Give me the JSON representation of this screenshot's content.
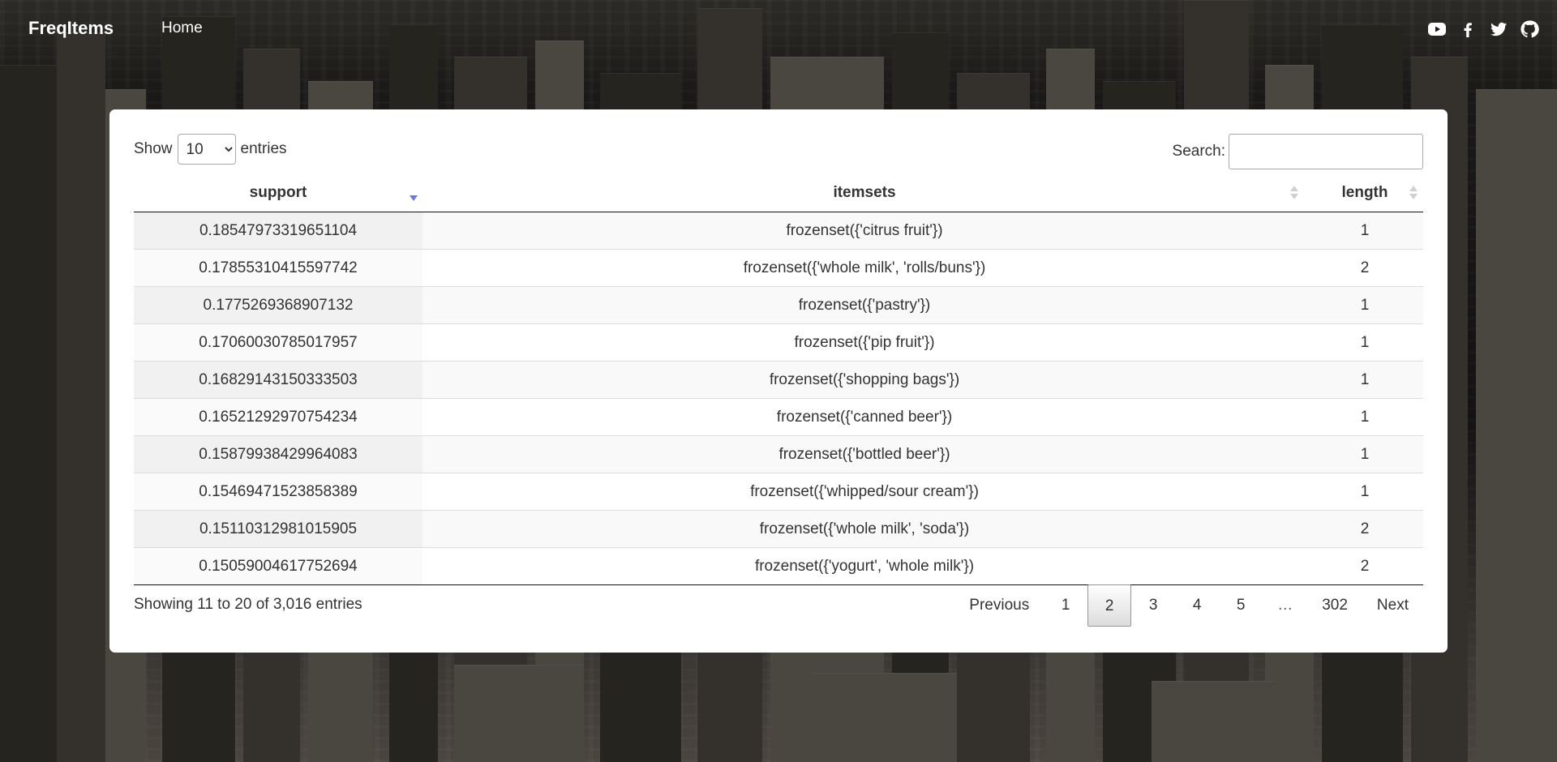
{
  "nav": {
    "brand": "FreqItems",
    "home": "Home",
    "social_icons": [
      "youtube-icon",
      "facebook-icon",
      "twitter-icon",
      "github-icon"
    ]
  },
  "table_controls": {
    "show_label": "Show",
    "entries_label": "entries",
    "page_length": "10",
    "search_label": "Search:",
    "search_value": ""
  },
  "columns": [
    {
      "label": "support",
      "sort": "descending"
    },
    {
      "label": "itemsets",
      "sort": "none"
    },
    {
      "label": "length",
      "sort": "none"
    }
  ],
  "rows": [
    {
      "support": "0.18547973319651104",
      "itemsets": "frozenset({'citrus fruit'})",
      "length": "1"
    },
    {
      "support": "0.17855310415597742",
      "itemsets": "frozenset({'whole milk', 'rolls/buns'})",
      "length": "2"
    },
    {
      "support": "0.1775269368907132",
      "itemsets": "frozenset({'pastry'})",
      "length": "1"
    },
    {
      "support": "0.17060030785017957",
      "itemsets": "frozenset({'pip fruit'})",
      "length": "1"
    },
    {
      "support": "0.16829143150333503",
      "itemsets": "frozenset({'shopping bags'})",
      "length": "1"
    },
    {
      "support": "0.16521292970754234",
      "itemsets": "frozenset({'canned beer'})",
      "length": "1"
    },
    {
      "support": "0.15879938429964083",
      "itemsets": "frozenset({'bottled beer'})",
      "length": "1"
    },
    {
      "support": "0.15469471523858389",
      "itemsets": "frozenset({'whipped/sour cream'})",
      "length": "1"
    },
    {
      "support": "0.15110312981015905",
      "itemsets": "frozenset({'whole milk', 'soda'})",
      "length": "2"
    },
    {
      "support": "0.15059004617752694",
      "itemsets": "frozenset({'yogurt', 'whole milk'})",
      "length": "2"
    }
  ],
  "info": "Showing 11 to 20 of 3,016 entries",
  "pagination": {
    "previous": "Previous",
    "pages": [
      "1",
      "2",
      "3",
      "4",
      "5",
      "…",
      "302"
    ],
    "current": "2",
    "next": "Next"
  },
  "colors": {
    "sort_active": "#6a7ad8",
    "card_bg": "#ffffff"
  }
}
